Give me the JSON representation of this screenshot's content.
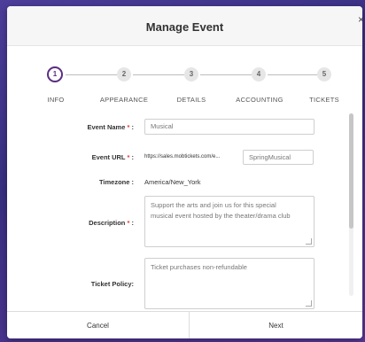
{
  "modal": {
    "title": "Manage Event",
    "close": "×"
  },
  "stepper": {
    "steps": [
      {
        "number": "1",
        "label": "INFO"
      },
      {
        "number": "2",
        "label": "APPEARANCE"
      },
      {
        "number": "3",
        "label": "DETAILS"
      },
      {
        "number": "4",
        "label": "ACCOUNTING"
      },
      {
        "number": "5",
        "label": "TICKETS"
      }
    ],
    "active_step": 1
  },
  "form": {
    "event_name": {
      "label": "Event Name",
      "required": "*",
      "suffix": ":",
      "value": "Musical"
    },
    "event_url": {
      "label": "Event URL",
      "required": "*",
      "suffix": ":",
      "prefix": "https://sales.mobtickets.com/e...",
      "value": "SpringMusical"
    },
    "timezone": {
      "label": "Timezone :",
      "value": "America/New_York"
    },
    "description": {
      "label": "Description",
      "required": "*",
      "suffix": ":",
      "line1": "Support the arts and join us for this special",
      "line2": "musical event hosted by the theater/drama club"
    },
    "ticket_policy": {
      "label": "Ticket Policy:",
      "value": "Ticket purchases non-refundable"
    }
  },
  "footer": {
    "cancel_label": "Cancel",
    "next_label": "Next"
  },
  "colors": {
    "accent": "#5a2d82",
    "required": "#e53935"
  }
}
